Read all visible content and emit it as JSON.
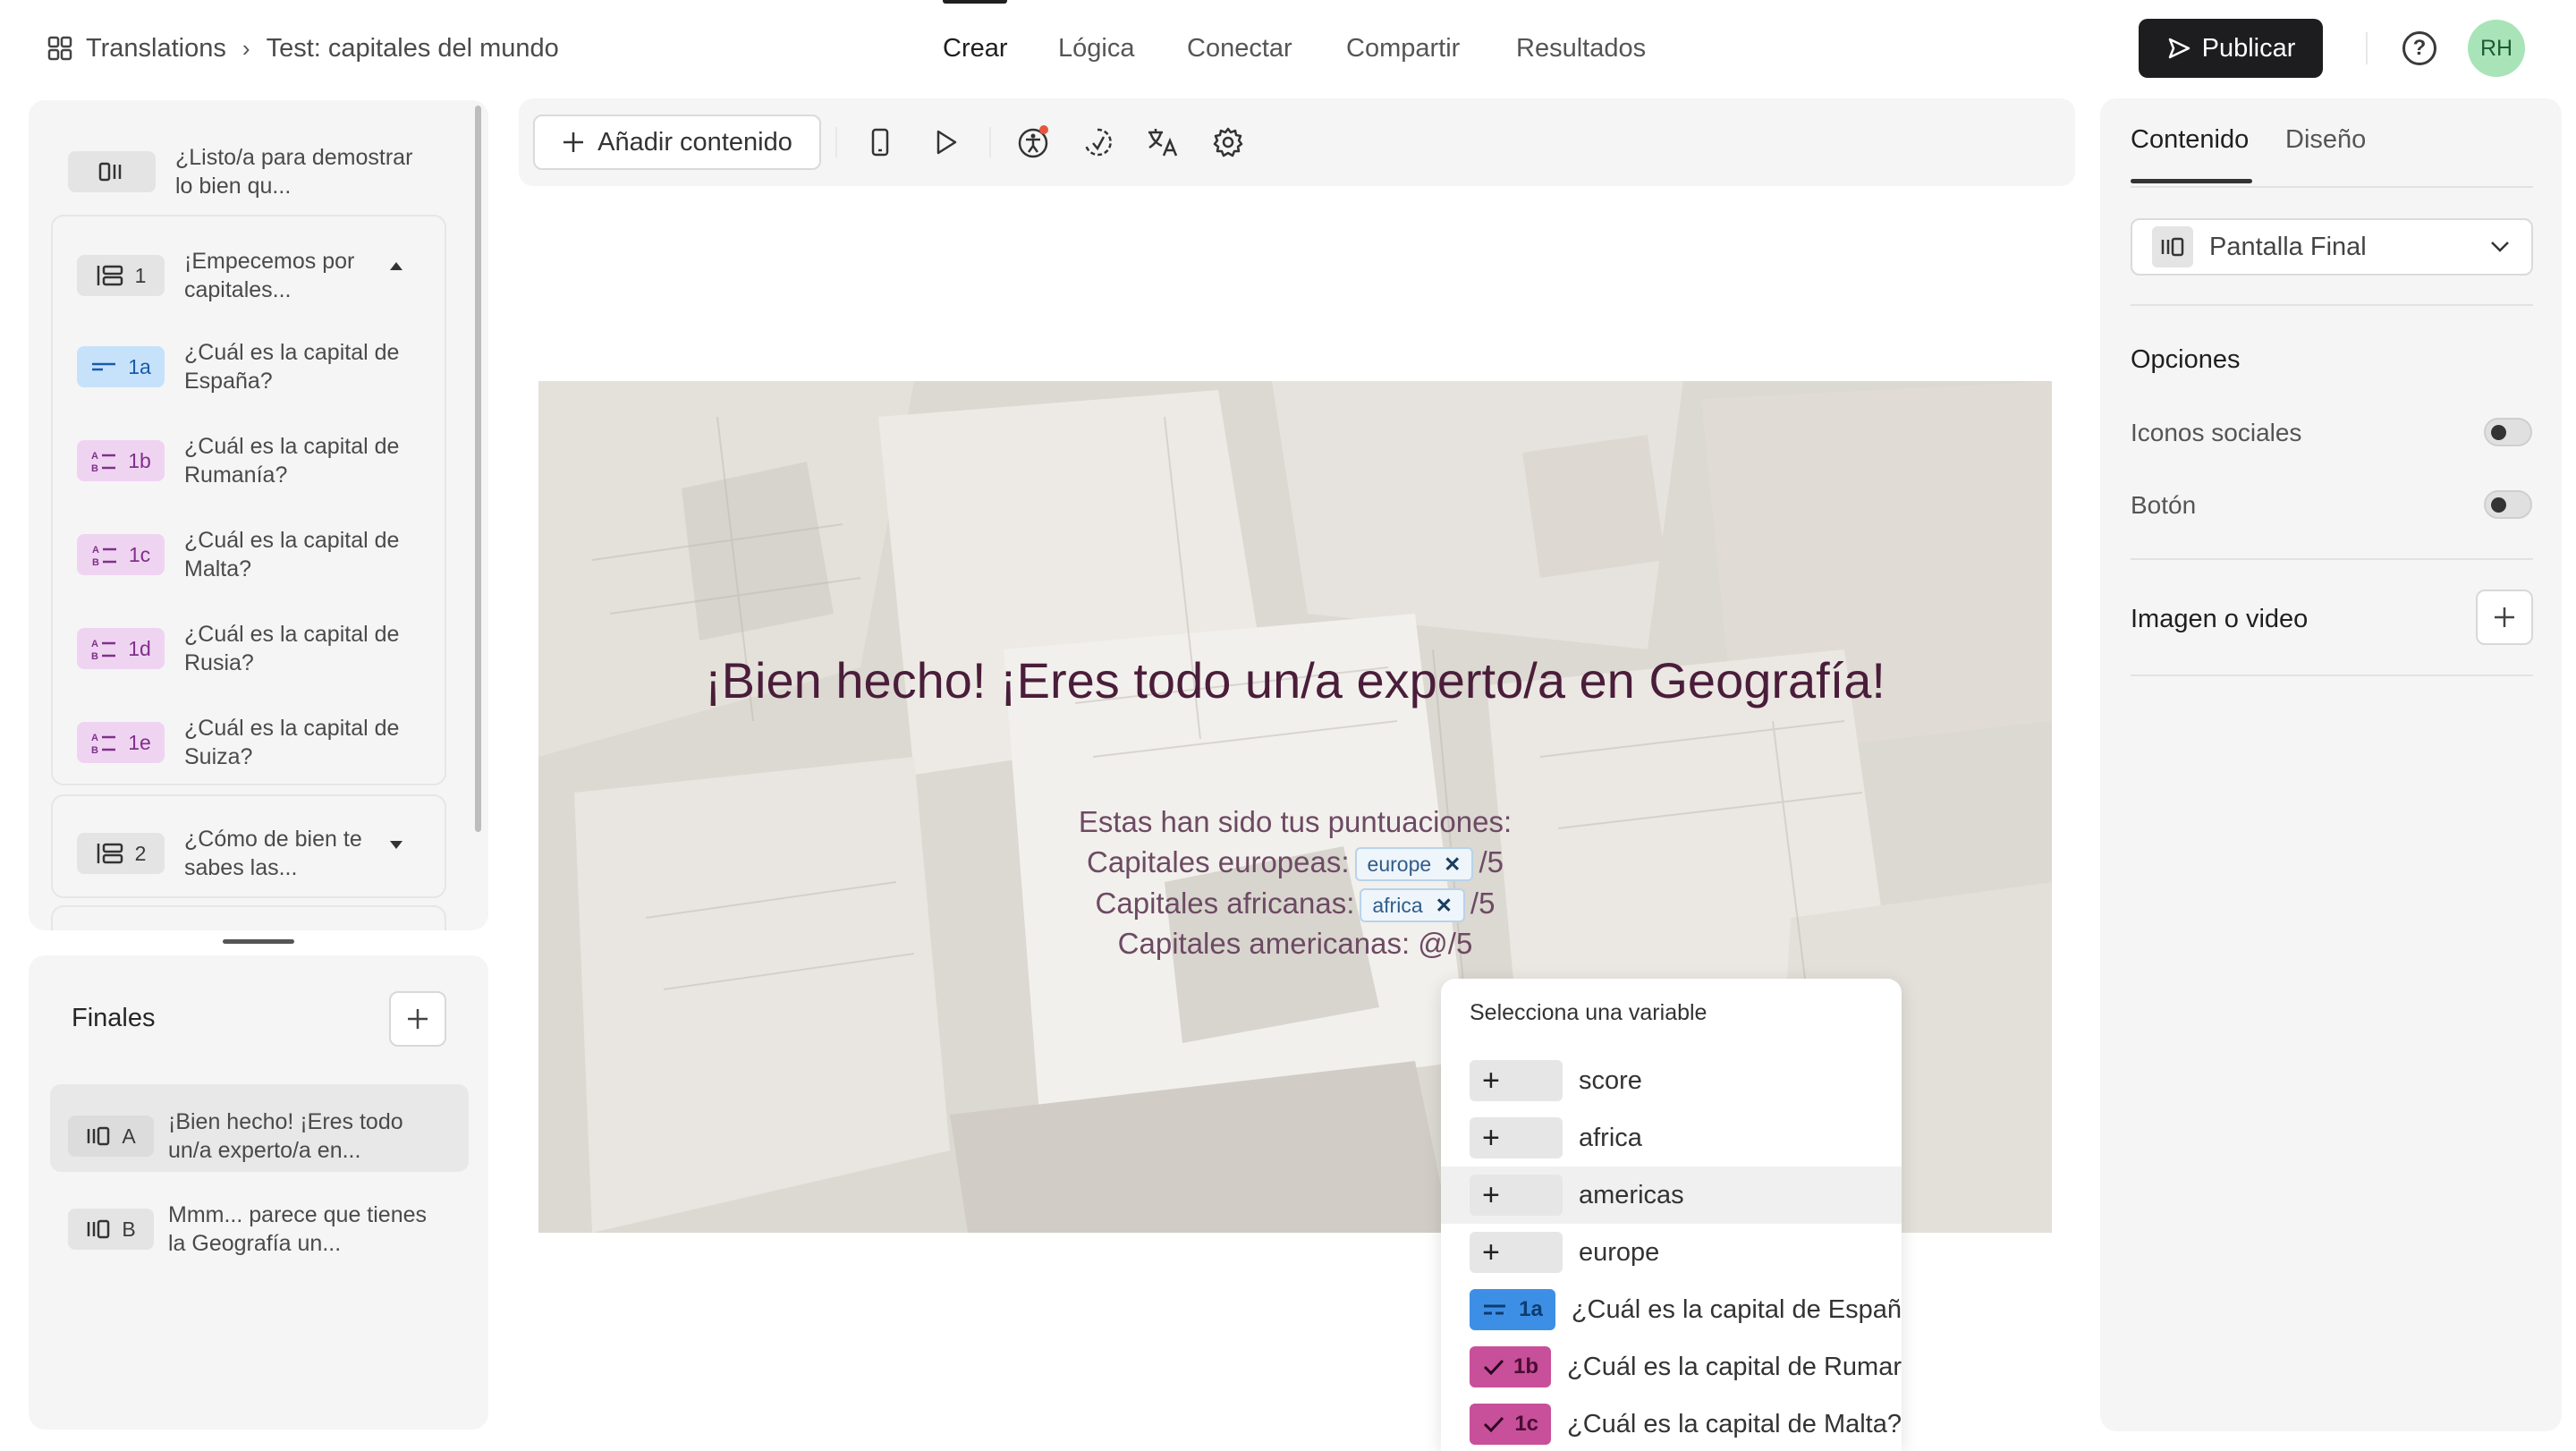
{
  "breadcrumb": {
    "root": "Translations",
    "current": "Test: capitales del mundo"
  },
  "nav_tabs": [
    {
      "label": "Crear",
      "active": true
    },
    {
      "label": "Lógica"
    },
    {
      "label": "Conectar"
    },
    {
      "label": "Compartir"
    },
    {
      "label": "Resultados"
    }
  ],
  "header": {
    "publish_label": "Publicar",
    "help_icon": "?",
    "avatar_initials": "RH"
  },
  "left_sidebar": {
    "welcome": {
      "label": "¿Listo/a para demostrar lo bien qu..."
    },
    "group1": {
      "number": "1",
      "label": "¡Empecemos por capitales...",
      "expanded": true,
      "items": [
        {
          "id": "1a",
          "label": "¿Cuál es la capital de España?",
          "color": "blue"
        },
        {
          "id": "1b",
          "label": "¿Cuál es la capital de Rumanía?",
          "color": "purple"
        },
        {
          "id": "1c",
          "label": "¿Cuál es la capital de Malta?",
          "color": "purple"
        },
        {
          "id": "1d",
          "label": "¿Cuál es la capital de Rusia?",
          "color": "purple"
        },
        {
          "id": "1e",
          "label": "¿Cuál es la capital de Suiza?",
          "color": "purple"
        }
      ]
    },
    "group2": {
      "number": "2",
      "label": "¿Cómo de bien te sabes las...",
      "expanded": false
    },
    "endings": {
      "title": "Finales",
      "items": [
        {
          "id": "A",
          "label": "¡Bien hecho! ¡Eres todo un/a experto/a en...",
          "selected": true
        },
        {
          "id": "B",
          "label": "Mmm... parece que tienes la Geografía un..."
        }
      ]
    }
  },
  "toolbar": {
    "add_content_label": "Añadir contenido"
  },
  "canvas": {
    "headline": "¡Bien hecho! ¡Eres todo un/a experto/a en Geografía!",
    "scores_intro": "Estas han sido tus puntuaciones:",
    "europe_prefix": "Capitales europeas:",
    "europe_chip": "europe",
    "europe_suffix": "/5",
    "africa_prefix": "Capitales africanas:",
    "africa_chip": "africa",
    "africa_suffix": "/5",
    "americas_line": "Capitales americanas: @/5"
  },
  "variable_dropdown": {
    "title": "Selecciona una variable",
    "items": [
      {
        "tag": "+",
        "label": "score"
      },
      {
        "tag": "+",
        "label": "africa"
      },
      {
        "tag": "+",
        "label": "americas",
        "highlighted": true
      },
      {
        "tag": "+",
        "label": "europe"
      },
      {
        "tag": "1a",
        "label": "¿Cuál es la capital de Españ",
        "color": "#3d8fe6"
      },
      {
        "tag": "1b",
        "label": "¿Cuál es la capital de Rumar",
        "color": "#c84f9a"
      },
      {
        "tag": "1c",
        "label": "¿Cuál es la capital de Malta?",
        "color": "#c84f9a"
      }
    ]
  },
  "right_panel": {
    "tabs": [
      {
        "label": "Contenido",
        "active": true
      },
      {
        "label": "Diseño"
      }
    ],
    "screen_select": "Pantalla Final",
    "options_title": "Opciones",
    "social_icons_label": "Iconos sociales",
    "social_icons_on": false,
    "button_label": "Botón",
    "button_on": false,
    "media_label": "Imagen o video"
  }
}
